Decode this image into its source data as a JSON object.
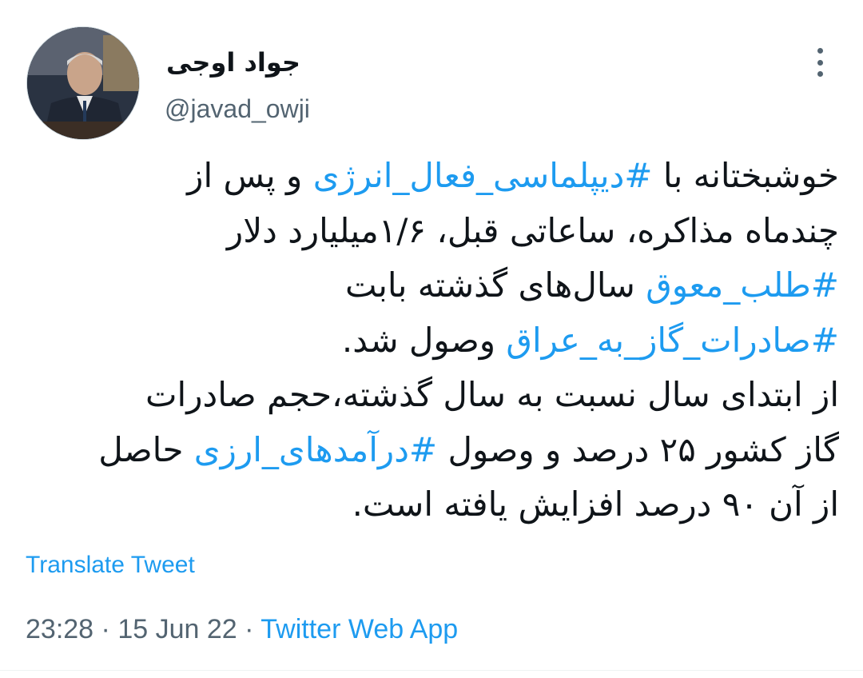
{
  "author": {
    "name": "جواد اوجی",
    "handle": "@javad_owji",
    "avatar_icon": "profile-photo"
  },
  "more_icon": "more-dots-vertical-icon",
  "tweet": {
    "lines": [
      [
        {
          "t": "خوشبختانه با "
        },
        {
          "t": "#دیپلماسی_فعال_انرژی",
          "tag": true
        },
        {
          "t": " و پس از"
        }
      ],
      [
        {
          "t": "چندماه مذاکره، ساعاتی قبل، ۱/۶میلیارد دلار"
        }
      ],
      [
        {
          "t": "#طلب_معوق",
          "tag": true
        },
        {
          "t": " سال‌های گذشته بابت"
        }
      ],
      [
        {
          "t": "#صادرات_گاز_به_عراق",
          "tag": true
        },
        {
          "t": " وصول شد."
        }
      ],
      [
        {
          "t": "از ابتدای سال نسبت به سال گذشته،حجم صادرات"
        }
      ],
      [
        {
          "t": "گاز کشور ۲۵ درصد و وصول "
        },
        {
          "t": "#درآمدهای_ارزی",
          "tag": true
        },
        {
          "t": " حاصل"
        }
      ],
      [
        {
          "t": "از آن ۹۰ درصد افزایش یافته است."
        }
      ]
    ]
  },
  "translate_label": "Translate Tweet",
  "meta": {
    "time": "23:28",
    "sep1": " · ",
    "date": "15 Jun 22",
    "sep2": " · ",
    "app": "Twitter Web App"
  },
  "colors": {
    "link": "#1d9bf0",
    "secondary": "#536471",
    "text": "#0f1419"
  }
}
